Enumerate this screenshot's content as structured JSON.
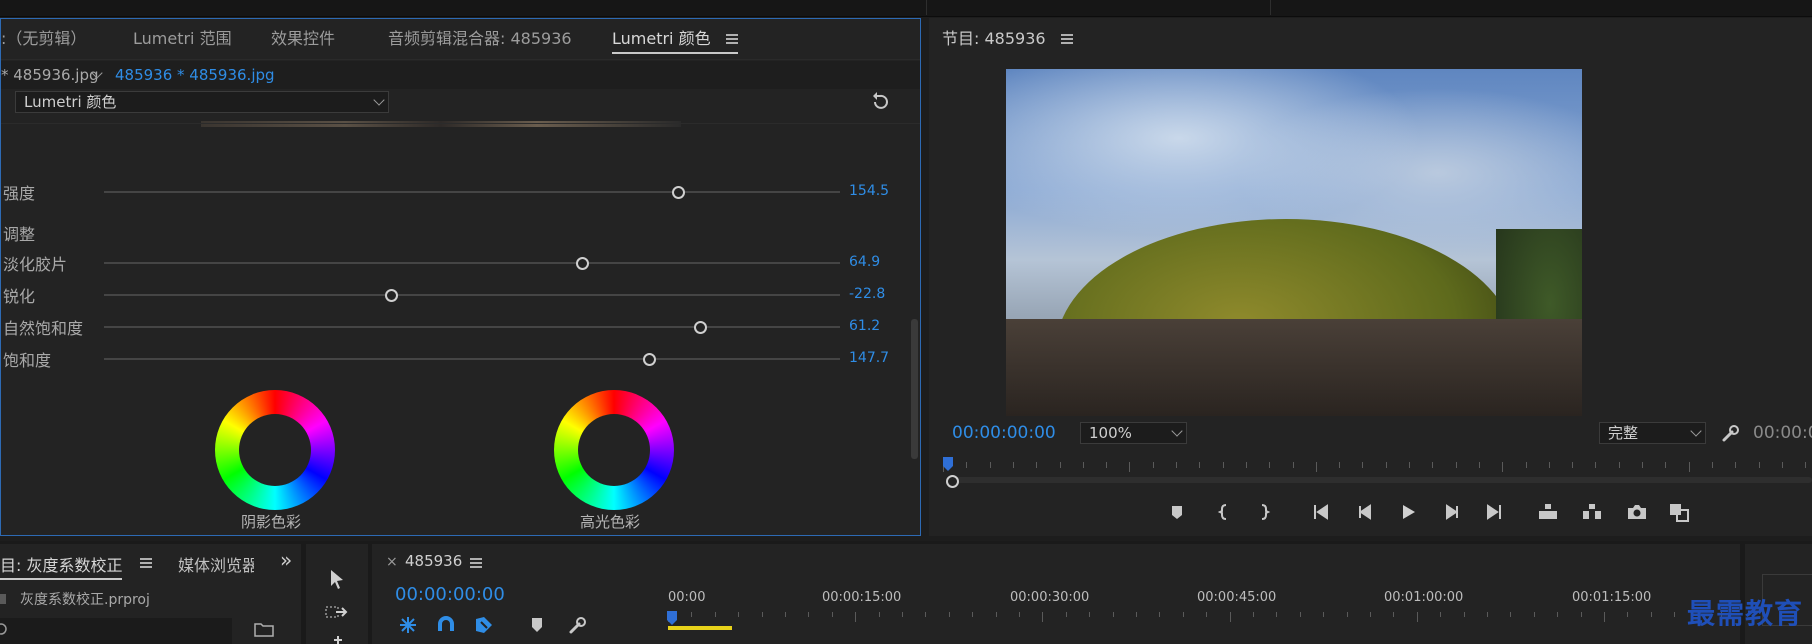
{
  "lumetri": {
    "tabs": [
      {
        "label": ":（无剪辑）"
      },
      {
        "label": "Lumetri 范围"
      },
      {
        "label": "效果控件"
      },
      {
        "label": "音频剪辑混合器: 485936"
      },
      {
        "label": "Lumetri 颜色",
        "active": true
      }
    ],
    "clip_left": "* 485936.jpg",
    "clip_right": "485936 * 485936.jpg",
    "effect_dropdown": "Lumetri 颜色",
    "sliders": [
      {
        "label": "强度",
        "value": "154.5",
        "fraction": 0.78
      },
      {
        "label": "淡化胶片",
        "value": "64.9",
        "fraction": 0.65
      },
      {
        "label": "锐化",
        "value": "-22.8",
        "fraction": 0.39
      },
      {
        "label": "自然饱和度",
        "value": "61.2",
        "fraction": 0.81
      },
      {
        "label": "饱和度",
        "value": "147.7",
        "fraction": 0.74
      }
    ],
    "section_adjust": "调整",
    "wheels": [
      {
        "label": "阴影色彩"
      },
      {
        "label": "高光色彩"
      }
    ]
  },
  "program": {
    "title": "节目: 485936",
    "timecode": "00:00:00:00",
    "zoom": "100%",
    "quality": "完整",
    "timecode_right": "00:00:0"
  },
  "project": {
    "tab_title": "目: 灰度系数校正",
    "tab2": "媒体浏览器",
    "file": "灰度系数校正.prproj"
  },
  "timeline": {
    "sequence_name": "485936",
    "close_glyph": "×",
    "timecode": "00:00:00:00",
    "ruler": [
      "00:00",
      "00:00:15:00",
      "00:00:30:00",
      "00:00:45:00",
      "00:01:00:00",
      "00:01:15:00"
    ]
  },
  "watermark": "最需教育",
  "colors": {
    "accent_blue": "#2f8de6",
    "panel_border": "#2d6ab4",
    "playhead": "#2f6fd6",
    "work_area": "#e8d21a"
  },
  "icons": [
    "menu-icon",
    "chevron-down-icon",
    "reset-icon",
    "wrench-icon",
    "marker-icon",
    "mark-in-icon",
    "mark-out-icon",
    "go-to-in-icon",
    "step-back-icon",
    "play-icon",
    "step-forward-icon",
    "go-to-out-icon",
    "lift-icon",
    "extract-icon",
    "camera-icon",
    "compare-icon",
    "selection-tool-icon",
    "track-select-tool-icon",
    "expand-panels-icon",
    "snap-icon",
    "link-icon",
    "add-marker-icon",
    "timeline-settings-icon",
    "folder-icon",
    "search-icon"
  ]
}
